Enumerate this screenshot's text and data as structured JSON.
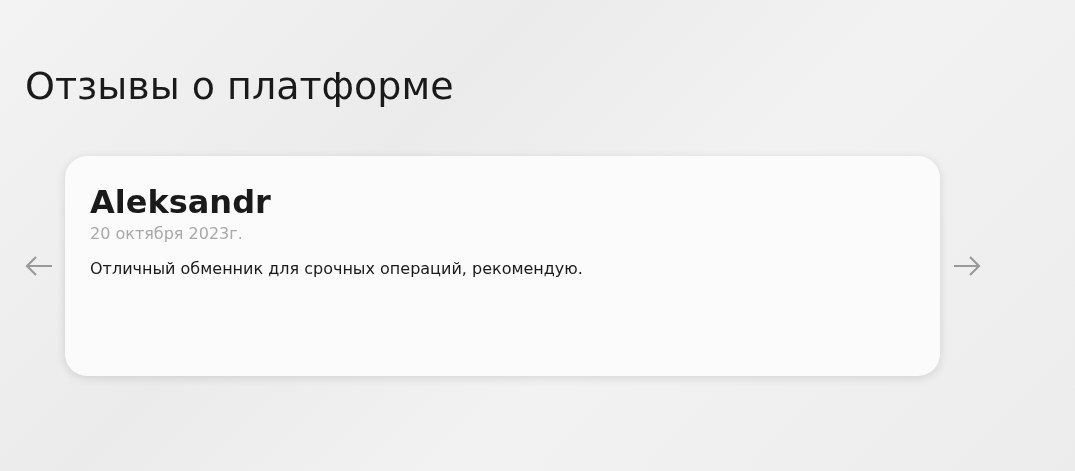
{
  "heading": "Отзывы о платформе",
  "reviews": [
    {
      "author": "Aleksandr",
      "date": "20 октября 2023г.",
      "text": "Отличный обменник для срочных операций, рекомендую."
    }
  ]
}
